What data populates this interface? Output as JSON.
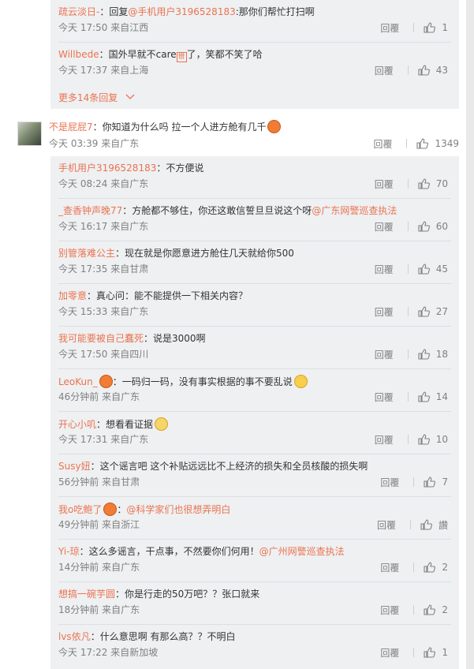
{
  "thread_top": {
    "replies": [
      {
        "user": "疏云淡日-",
        "sep": "：",
        "text_before": "回复",
        "mention": "@手机用户3196528183",
        "text_after": ":那你们帮忙打扫啊",
        "emoji": "",
        "meta": "今天 17:50 来自江西",
        "reply": "回覆",
        "likes": "1"
      },
      {
        "user": "Willbede",
        "sep": "：",
        "text_before": "国外早就不care",
        "mention": "",
        "text_after": "了，笑都不笑了哈",
        "emoji": "",
        "glyph": "卌",
        "meta": "今天 17:37 来自上海",
        "reply": "回覆",
        "likes": "43"
      }
    ],
    "more_label": "更多14条回复"
  },
  "main_comment": {
    "user": "不是屁屁7",
    "sep": "：",
    "text": "你知道为什么吗 拉一个人进方舱有几千",
    "meta": "今天 03:39 来自广东",
    "reply": "回覆",
    "likes": "1349"
  },
  "thread_main": {
    "replies": [
      {
        "user": "手机用户3196528183",
        "sep": "：",
        "text_before": "不方便说",
        "mention": "",
        "text_after": "",
        "meta": "今天 08:24 来自广东",
        "reply": "回覆",
        "likes": "70"
      },
      {
        "user": "_查香钟声晚77",
        "sep": "：",
        "text_before": "方舱都不够住，你还这敢信誓旦旦说这个呀",
        "mention": "@广东网警巡查执法",
        "text_after": "",
        "meta": "今天 16:17 来自广东",
        "reply": "回覆",
        "likes": "60"
      },
      {
        "user": "别管落难公主",
        "sep": "：",
        "text_before": "现在就是你愿意进方舱住几天就给你500",
        "mention": "",
        "text_after": "",
        "meta": "今天 17:35 来自甘肃",
        "reply": "回覆",
        "likes": "45"
      },
      {
        "user": "加零意",
        "sep": "：",
        "text_before": "真心问：能不能提供一下相关内容？",
        "mention": "",
        "text_after": "",
        "meta": "今天 15:33 来自广东",
        "reply": "回覆",
        "likes": "27"
      },
      {
        "user": "我可能要被自己蠢死",
        "sep": "：",
        "text_before": "说是3000啊",
        "mention": "",
        "text_after": "",
        "meta": "今天 17:50 来自四川",
        "reply": "回覆",
        "likes": "18"
      },
      {
        "user": "LeoKun_",
        "sep": "：",
        "text_before": "一码归一码，没有事实根据的事不要乱说",
        "mention": "",
        "text_after": "",
        "meta": "46分钟前 来自广东",
        "reply": "回覆",
        "likes": "14"
      },
      {
        "user": "开心小叽",
        "sep": "：",
        "text_before": "想看看证据",
        "mention": "",
        "text_after": "",
        "meta": "今天 17:31 来自广东",
        "reply": "回覆",
        "likes": "10"
      },
      {
        "user": "Susy妞",
        "sep": "：",
        "text_before": "这个谣言吧 这个补贴远远比不上经济的损失和全员核酸的损失啊",
        "mention": "",
        "text_after": "",
        "meta": "56分钟前 来自甘肃",
        "reply": "回覆",
        "likes": "7"
      },
      {
        "user": "我o吃鲍了",
        "sep": "：",
        "text_before": "",
        "mention": "@科学家们也很想弄明白",
        "text_after": "",
        "meta": "49分钟前 来自浙江",
        "reply": "回覆",
        "likes": "讚"
      },
      {
        "user": "Yi-琼",
        "sep": "：",
        "text_before": "这么多谣言，干点事，不然要你们何用！",
        "mention": "@广州网警巡查执法",
        "text_after": "",
        "meta": "14分钟前 来自广东",
        "reply": "回覆",
        "likes": "2"
      },
      {
        "user": "想搞一碗芋圆",
        "sep": "：",
        "text_before": "你是行走的50万吧？？张口就来",
        "mention": "",
        "text_after": "",
        "meta": "18分钟前 来自广东",
        "reply": "回覆",
        "likes": "2"
      },
      {
        "user": "lvs依凡",
        "sep": "：",
        "text_before": "什么意思啊 有那么高？？不明白",
        "mention": "",
        "text_after": "",
        "meta": "今天 17:22 来自新加坡",
        "reply": "回覆",
        "likes": "1"
      }
    ]
  }
}
